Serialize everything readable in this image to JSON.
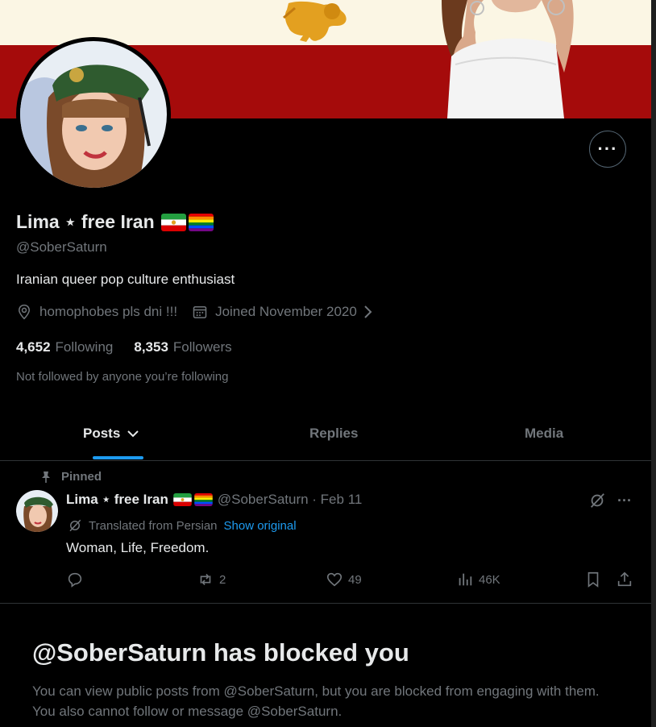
{
  "profile": {
    "display_name": "Lima ⋆ free Iran",
    "handle": "@SoberSaturn",
    "bio": "Iranian queer pop culture enthusiast",
    "location": "homophobes pls dni !!!",
    "joined": "Joined November 2020",
    "following_count": "4,652",
    "following_label": "Following",
    "followers_count": "8,353",
    "followers_label": "Followers",
    "not_followed": "Not followed by anyone you’re following"
  },
  "tabs": [
    {
      "label": "Posts"
    },
    {
      "label": "Replies"
    },
    {
      "label": "Media"
    }
  ],
  "post": {
    "pinned_label": "Pinned",
    "author_name": "Lima ⋆ free Iran",
    "author_meta": "@SoberSaturn · Feb 11",
    "translated_label": "Translated from Persian",
    "show_original": "Show original",
    "text": "Woman, Life, Freedom.",
    "reposts": "2",
    "likes": "49",
    "views": "46K"
  },
  "blocked": {
    "title": "@SoberSaturn has blocked you",
    "description": "You can view public posts from @SoberSaturn, but you are blocked from engaging with them. You also cannot follow or message @SoberSaturn."
  },
  "colors": {
    "background": "#000000",
    "accent": "#1d9bf0",
    "muted": "#71767b",
    "banner_red": "#a50b0b",
    "banner_cream": "#fbf6e4"
  }
}
